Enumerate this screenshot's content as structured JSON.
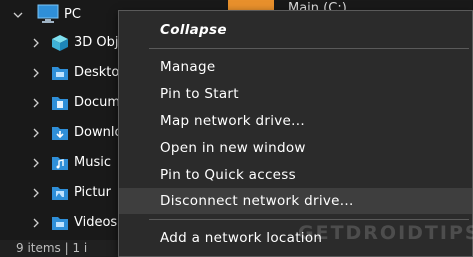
{
  "nav": {
    "pc": {
      "label": "PC",
      "icon": "computer-icon"
    },
    "items": [
      {
        "label": "3D Obj",
        "icon": "3d-objects-icon"
      },
      {
        "label": "Deskto",
        "icon": "folder-icon"
      },
      {
        "label": "Docume",
        "icon": "folder-icon"
      },
      {
        "label": "Downlo",
        "icon": "folder-icon"
      },
      {
        "label": "Music",
        "icon": "folder-icon"
      },
      {
        "label": "Pictur",
        "icon": "folder-icon"
      },
      {
        "label": "Videos",
        "icon": "folder-icon"
      }
    ]
  },
  "status": {
    "text": "9 items | 1 i"
  },
  "content": {
    "drive_label": "Main (C:)",
    "drive_color": "#e8902c"
  },
  "context_menu": {
    "items": [
      {
        "label": "Collapse",
        "bold": true
      },
      {
        "label": "Manage"
      },
      {
        "label": "Pin to Start"
      },
      {
        "label": "Map network drive..."
      },
      {
        "label": "Open in new window"
      },
      {
        "label": "Pin to Quick access"
      },
      {
        "label": "Disconnect network drive...",
        "highlighted": true
      },
      {
        "label": "Add a network location"
      }
    ]
  },
  "watermark": {
    "text": "GETDROIDTIPS"
  },
  "colors": {
    "folder_blue": "#2f8fd8",
    "menu_bg": "#2b2b2b",
    "highlight": "#3e3e3e"
  }
}
